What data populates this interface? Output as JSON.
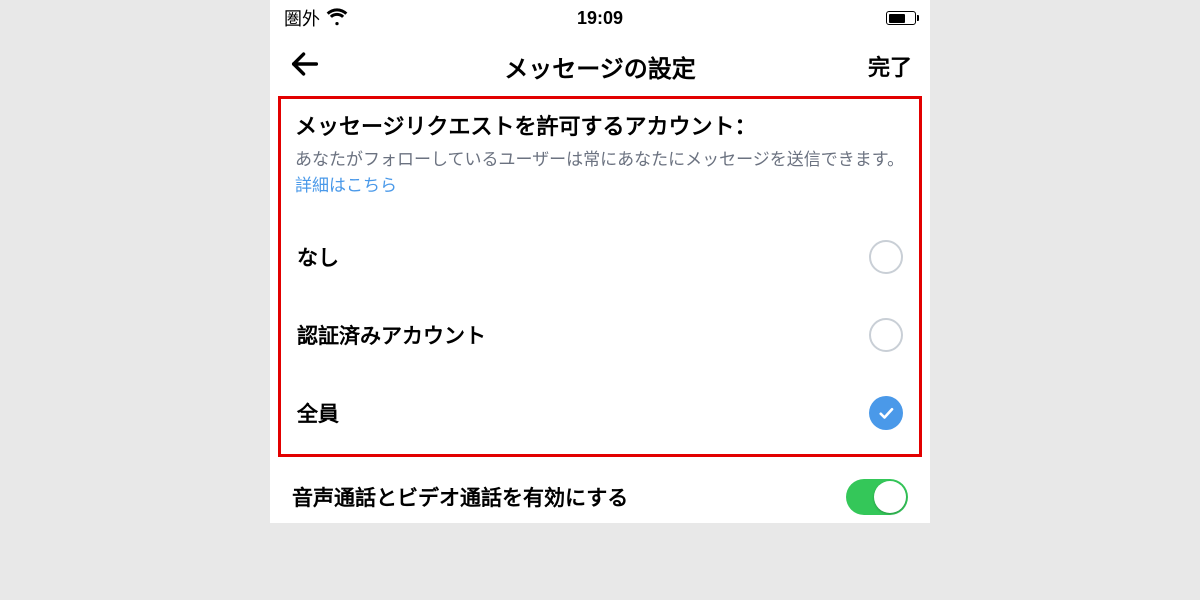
{
  "statusBar": {
    "carrier": "圏外",
    "time": "19:09"
  },
  "nav": {
    "title": "メッセージの設定",
    "done": "完了"
  },
  "section": {
    "title": "メッセージリクエストを許可するアカウント：",
    "descPrefix": "あなたがフォローしているユーザーは常にあなたにメッセージを送信できます。",
    "link": "詳細はこちら"
  },
  "options": {
    "none": "なし",
    "verified": "認証済みアカウント",
    "everyone": "全員"
  },
  "toggle": {
    "label": "音声通話とビデオ通話を有効にする"
  }
}
